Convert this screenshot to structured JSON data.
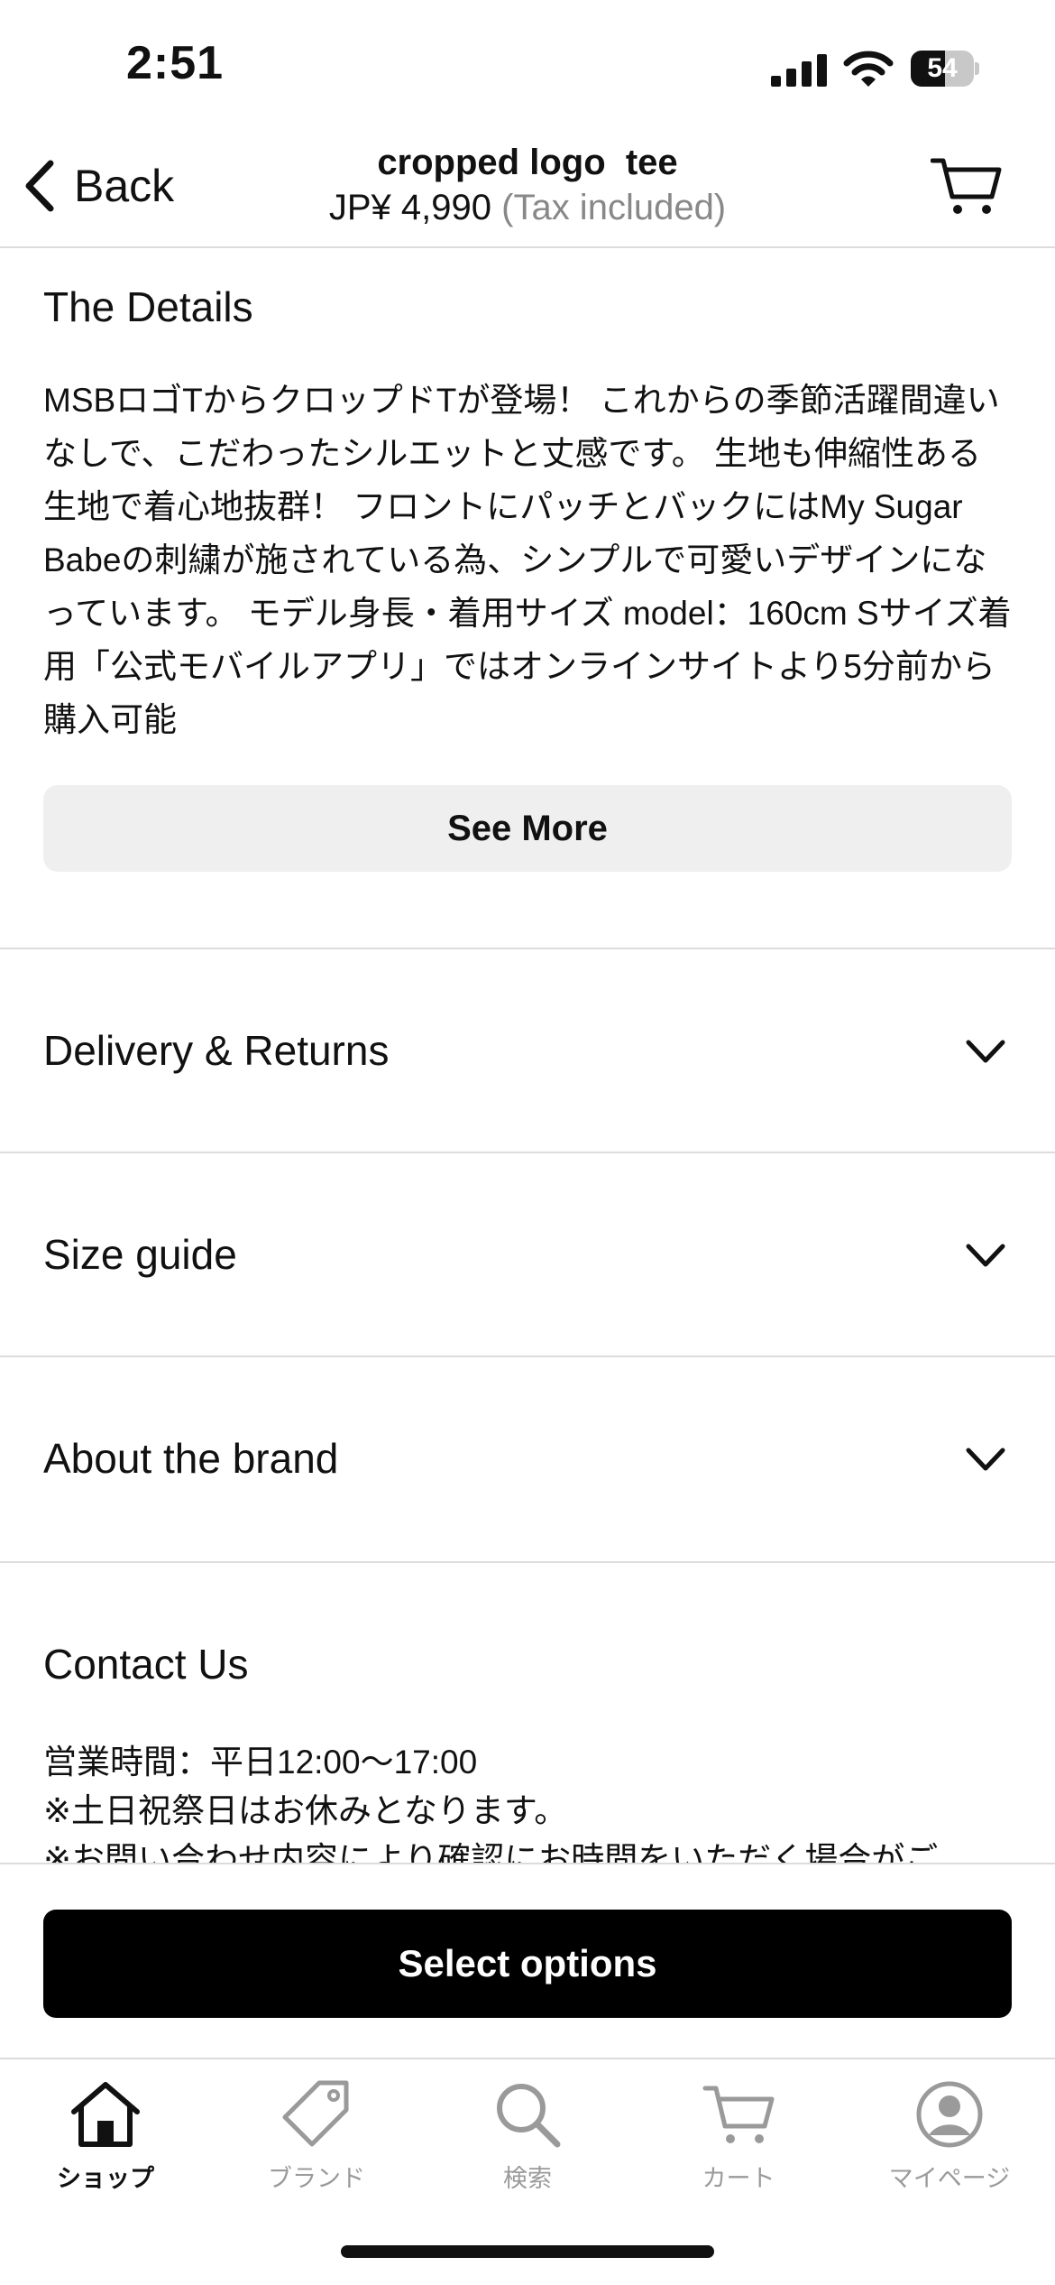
{
  "status_bar": {
    "time": "2:51",
    "battery_percent": "54",
    "battery_level": 0.54
  },
  "nav": {
    "back_label": "Back",
    "title": "cropped logo  tee",
    "price": "JP¥ 4,990",
    "tax_note": "(Tax included)"
  },
  "details": {
    "heading": "The Details",
    "body": "MSBロゴTからクロップドTが登場！ これからの季節活躍間違いなしで、こだわったシルエットと丈感です。 生地も伸縮性ある生地で着心地抜群！ フロントにパッチとバックにはMy Sugar Babeの刺繍が施されている為、シンプルで可愛いデザインになっています。 モデル身長・着用サイズ model：160cm Sサイズ着用「公式モバイルアプリ」ではオンラインサイトより5分前から購入可能",
    "see_more_label": "See More"
  },
  "sections": [
    {
      "label": "Delivery & Returns"
    },
    {
      "label": "Size guide"
    },
    {
      "label": "About the brand"
    }
  ],
  "contact": {
    "heading": "Contact Us",
    "lines": [
      "営業時間：平日12:00～17:00",
      "※土日祝祭日はお休みとなります。",
      "※お問い合わせ内容により確認にお時間をいただく場合がご"
    ]
  },
  "action": {
    "select_options_label": "Select options"
  },
  "tabbar": {
    "tabs": [
      {
        "label": "ショップ",
        "icon": "home-icon",
        "active": true
      },
      {
        "label": "ブランド",
        "icon": "tag-icon",
        "active": false
      },
      {
        "label": "検索",
        "icon": "search-icon",
        "active": false
      },
      {
        "label": "カート",
        "icon": "cart-icon",
        "active": false
      },
      {
        "label": "マイページ",
        "icon": "user-icon",
        "active": false
      }
    ]
  },
  "colors": {
    "primary_button": "#000000",
    "secondary_button": "#efefef",
    "divider": "#dcdcdc",
    "inactive_tab": "#9a9a9a"
  }
}
